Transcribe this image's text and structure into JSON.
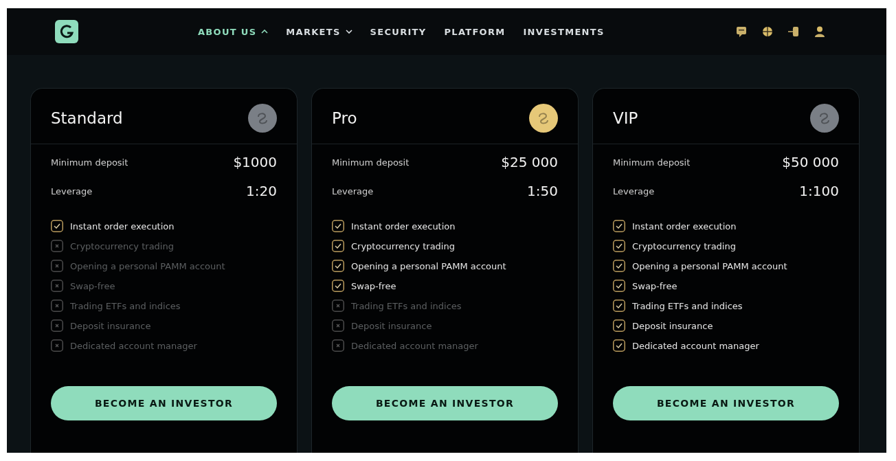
{
  "nav": {
    "items": [
      {
        "label": "ABOUT US",
        "kind": "dropdown",
        "expanded": true,
        "selected": true
      },
      {
        "label": "MARKETS",
        "kind": "dropdown",
        "expanded": false,
        "selected": false
      },
      {
        "label": "SECURITY",
        "kind": "link",
        "selected": false
      },
      {
        "label": "PLATFORM",
        "kind": "link",
        "selected": false
      },
      {
        "label": "INVESTMENTS",
        "kind": "link",
        "selected": false
      }
    ]
  },
  "plans": [
    {
      "name": "Standard",
      "color": "#7a7f86",
      "deposit_label": "Minimum deposit",
      "deposit": "$1000",
      "leverage_label": "Leverage",
      "leverage": "1:20",
      "button": "BECOME AN INVESTOR",
      "features": [
        {
          "label": "Instant order execution",
          "included": true
        },
        {
          "label": "Cryptocurrency trading",
          "included": false
        },
        {
          "label": "Opening a personal PAMM account",
          "included": false
        },
        {
          "label": "Swap-free",
          "included": false
        },
        {
          "label": "Trading ETFs and indices",
          "included": false
        },
        {
          "label": "Deposit insurance",
          "included": false
        },
        {
          "label": "Dedicated account manager",
          "included": false
        }
      ]
    },
    {
      "name": "Pro",
      "color": "#e6c878",
      "deposit_label": "Minimum deposit",
      "deposit": "$25 000",
      "leverage_label": "Leverage",
      "leverage": "1:50",
      "button": "BECOME AN INVESTOR",
      "features": [
        {
          "label": "Instant order execution",
          "included": true
        },
        {
          "label": "Cryptocurrency trading",
          "included": true
        },
        {
          "label": "Opening a personal PAMM account",
          "included": true
        },
        {
          "label": "Swap-free",
          "included": true
        },
        {
          "label": "Trading ETFs and indices",
          "included": false
        },
        {
          "label": "Deposit insurance",
          "included": false
        },
        {
          "label": "Dedicated account manager",
          "included": false
        }
      ]
    },
    {
      "name": "VIP",
      "color": "#7a7f86",
      "deposit_label": "Minimum deposit",
      "deposit": "$50 000",
      "leverage_label": "Leverage",
      "leverage": "1:100",
      "button": "BECOME AN INVESTOR",
      "features": [
        {
          "label": "Instant order execution",
          "included": true
        },
        {
          "label": "Cryptocurrency trading",
          "included": true
        },
        {
          "label": "Opening a personal PAMM account",
          "included": true
        },
        {
          "label": "Swap-free",
          "included": true
        },
        {
          "label": "Trading ETFs and indices",
          "included": true
        },
        {
          "label": "Deposit insurance",
          "included": true
        },
        {
          "label": "Dedicated account manager",
          "included": true
        }
      ]
    }
  ]
}
